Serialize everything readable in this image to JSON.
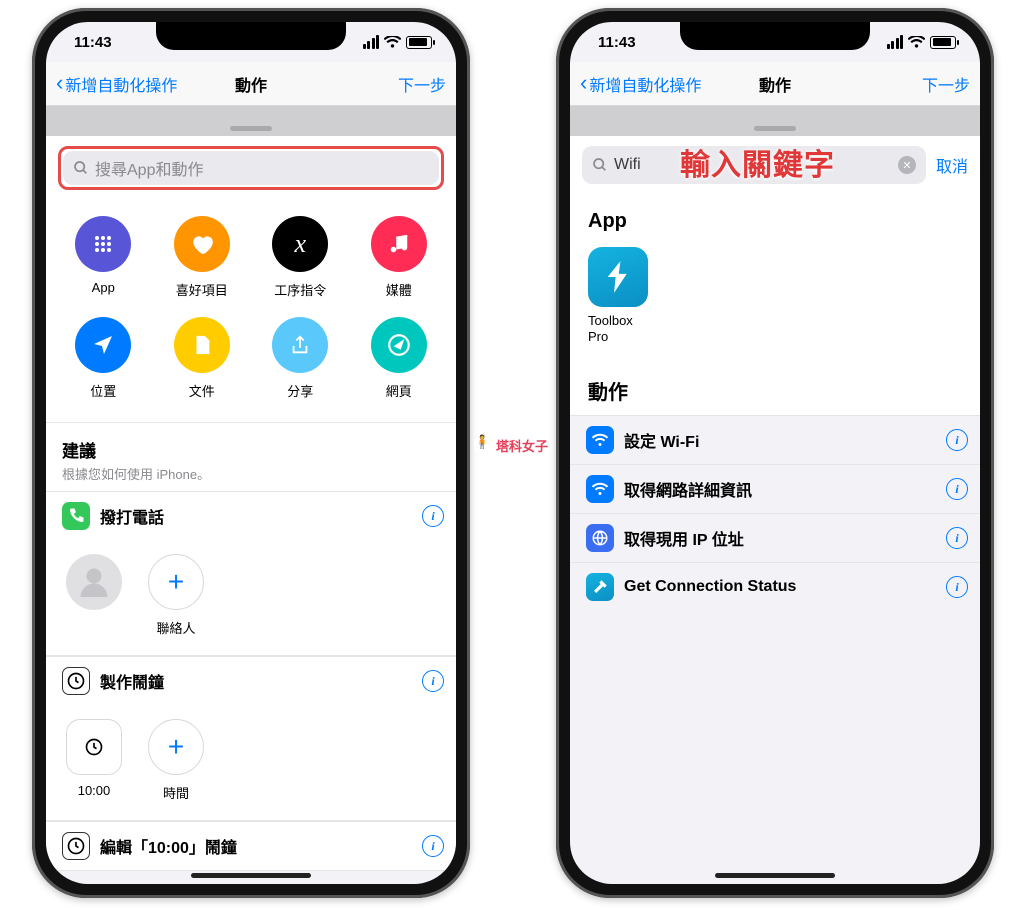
{
  "status": {
    "time": "11:43"
  },
  "nav": {
    "back": "新增自動化操作",
    "title": "動作",
    "next": "下一步"
  },
  "search": {
    "placeholder": "搜尋App和動作",
    "value": "Wifi",
    "cancel": "取消"
  },
  "categories": [
    {
      "label": "App",
      "icon": "grid",
      "color": "#5856d6"
    },
    {
      "label": "喜好項目",
      "icon": "heart",
      "color": "#ff9500"
    },
    {
      "label": "工序指令",
      "icon": "x",
      "color": "#000000"
    },
    {
      "label": "媒體",
      "icon": "music",
      "color": "#ff2d55"
    },
    {
      "label": "位置",
      "icon": "nav",
      "color": "#007aff"
    },
    {
      "label": "文件",
      "icon": "doc",
      "color": "#ffcc00"
    },
    {
      "label": "分享",
      "icon": "share",
      "color": "#5ac8fa"
    },
    {
      "label": "網頁",
      "icon": "compass",
      "color": "#00c7be"
    }
  ],
  "suggestions": {
    "title": "建議",
    "subtitle": "根據您如何使用 iPhone。",
    "groups": [
      {
        "title": "撥打電話",
        "icon_color": "#34c759",
        "options": [
          {
            "type": "contact_blank",
            "label": ""
          },
          {
            "type": "add",
            "label": "聯絡人"
          }
        ]
      },
      {
        "title": "製作鬧鐘",
        "icon_color": "#ffffff",
        "options": [
          {
            "type": "clock",
            "label": "10:00"
          },
          {
            "type": "add",
            "label": "時間"
          }
        ]
      },
      {
        "title": "編輯「10:00」鬧鐘",
        "icon_color": "#ffffff",
        "options": []
      }
    ]
  },
  "right": {
    "overlay": "輸入關鍵字",
    "app_section_title": "App",
    "app_result": {
      "name": "Toolbox\nPro"
    },
    "action_section_title": "動作",
    "actions": [
      {
        "label": "設定 Wi-Fi",
        "icon_bg": "#007aff",
        "glyph": "wifi"
      },
      {
        "label": "取得網路詳細資訊",
        "icon_bg": "#007aff",
        "glyph": "wifi"
      },
      {
        "label": "取得現用 IP 位址",
        "icon_bg": "#3a6df0",
        "glyph": "globe"
      },
      {
        "label": "Get Connection Status",
        "icon_bg": "gradient",
        "glyph": "hammer"
      }
    ]
  },
  "watermark": "塔科女子"
}
